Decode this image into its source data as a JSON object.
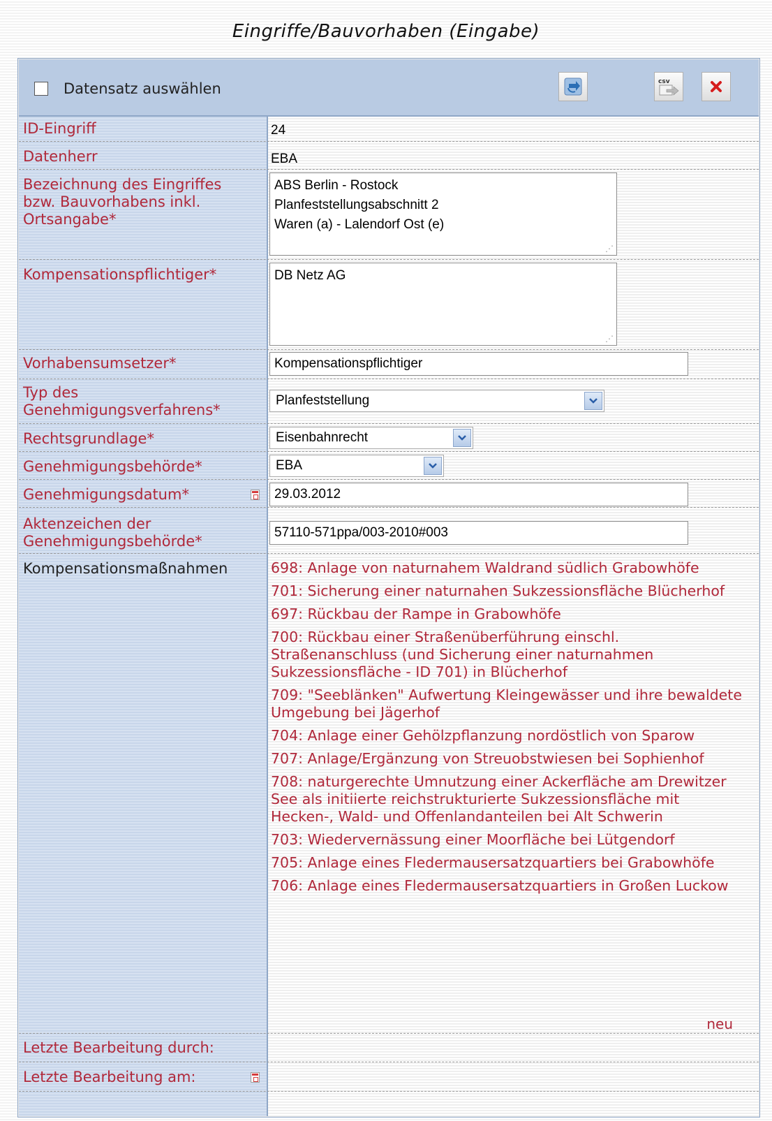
{
  "page": {
    "title": "Eingriffe/Bauvorhaben (Eingabe)"
  },
  "header": {
    "select_label": "Datensatz auswählen",
    "select_checked": false,
    "csv_label": "csv"
  },
  "form": {
    "id_label": "ID-Eingriff",
    "id_value": "24",
    "datenherr_label": "Datenherr",
    "datenherr_value": "EBA",
    "bezeichnung_label": "Bezeichnung des Eingriffes bzw. Bauvorhabens inkl. Ortsangabe*",
    "bezeichnung_value": "ABS Berlin - Rostock\nPlanfeststellungsabschnitt 2\nWaren (a) - Lalendorf Ost (e)",
    "kompensationspflichtiger_label": "Kompensationspflichtiger*",
    "kompensationspflichtiger_value": "DB Netz AG",
    "vorhabensumsetzer_label": "Vorhabensumsetzer*",
    "vorhabensumsetzer_value": "Kompensationspflichtiger",
    "typ_label": "Typ des Genehmigungsverfahrens*",
    "typ_value": "Planfeststellung",
    "rechtsgrundlage_label": "Rechtsgrundlage*",
    "rechtsgrundlage_value": "Eisenbahnrecht",
    "behoerde_label": "Genehmigungsbehörde*",
    "behoerde_value": "EBA",
    "datum_label": "Genehmigungsdatum*",
    "datum_value": "29.03.2012",
    "aktenzeichen_label": "Aktenzeichen der Genehmigungsbehörde*",
    "aktenzeichen_value": "57110-571ppa/003-2010#003",
    "massnahmen_label": "Kompensationsmaßnahmen",
    "massnahmen": [
      "698: Anlage von naturnahem Waldrand südlich Grabowhöfe",
      "701: Sicherung einer naturnahen Sukzessionsfläche Blücherhof",
      "697: Rückbau der Rampe in Grabowhöfe",
      "700: Rückbau einer Straßenüberführung einschl. Straßenanschluss (und Sicherung einer naturnahmen Sukzessionsfläche - ID 701) in Blücherhof",
      "709: \"Seeblänken\" Aufwertung Kleingewässer und ihre bewaldete Umgebung bei Jägerhof",
      "704: Anlage einer Gehölzpflanzung nordöstlich von Sparow",
      "707: Anlage/Ergänzung von Streuobstwiesen bei Sophienhof",
      "708: naturgerechte Umnutzung einer Ackerfläche am Drewitzer See als initiierte reichstrukturierte Sukzessionsfläche mit Hecken-, Wald- und Offenlandanteilen bei Alt Schwerin",
      "703: Wiedervernässung einer Moorfläche bei Lütgendorf",
      "705: Anlage eines Fledermausersatzquartiers bei Grabowhöfe",
      "706: Anlage eines Fledermausersatzquartiers in Großen Luckow"
    ],
    "neu_label": "neu",
    "bearbeitung_durch_label": "Letzte Bearbeitung durch:",
    "bearbeitung_am_label": "Letzte Bearbeitung am:"
  },
  "colors": {
    "label_red": "#b0283a",
    "header_blue": "#b9cbe3",
    "label_column_blue": "#d6e1f1"
  }
}
